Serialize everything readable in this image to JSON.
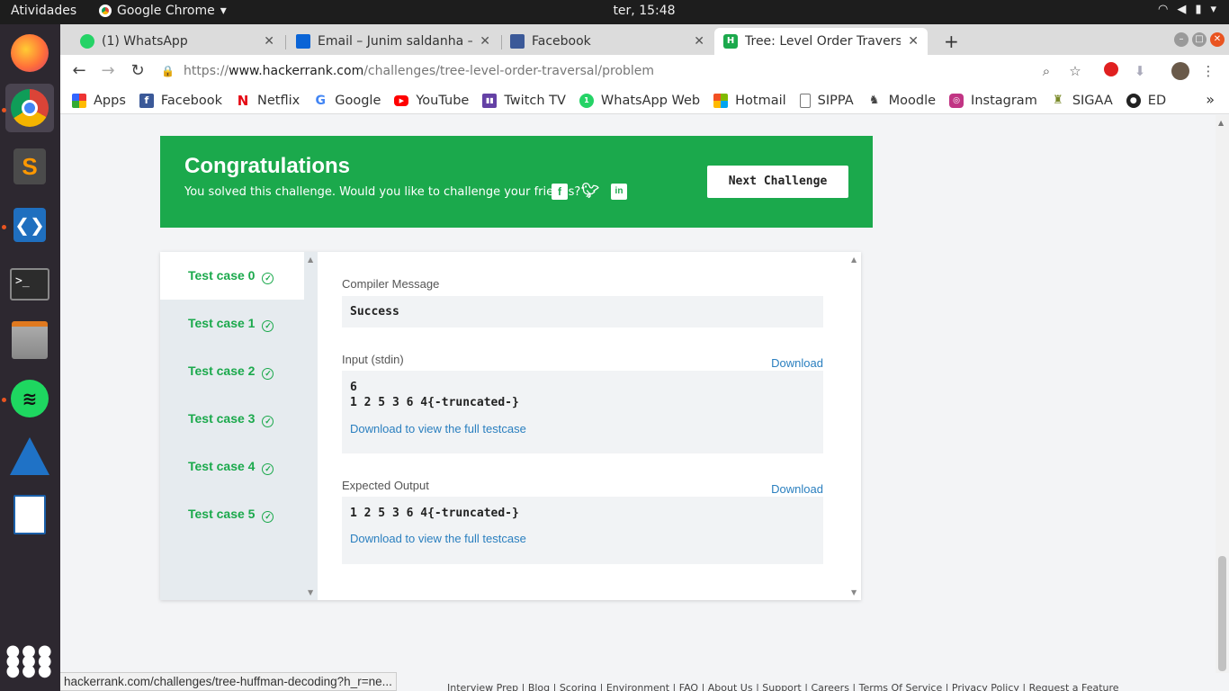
{
  "system": {
    "activities": "Atividades",
    "app_name": "Google Chrome",
    "clock": "ter, 15:48"
  },
  "tabs": [
    {
      "title": "(1) WhatsApp",
      "favicon_color": "#25d366"
    },
    {
      "title": "Email – Junim saldanha – O",
      "favicon_color": "#0a64d6"
    },
    {
      "title": "Facebook",
      "favicon_color": "#3b5998"
    },
    {
      "title": "Tree: Level Order Traversa",
      "favicon_color": "#1ba94c",
      "active": true
    }
  ],
  "address": {
    "protocol": "https://",
    "host": "www.hackerrank.com",
    "path": "/challenges/tree-level-order-traversal/problem"
  },
  "bookmarks": [
    {
      "label": "Apps",
      "icon": "apps-grid-icon",
      "color": "#e33"
    },
    {
      "label": "Facebook",
      "icon": "facebook-icon",
      "color": "#3b5998"
    },
    {
      "label": "Netflix",
      "icon": "netflix-icon",
      "color": "#e50914"
    },
    {
      "label": "Google",
      "icon": "google-icon",
      "color": "#4285f4"
    },
    {
      "label": "YouTube",
      "icon": "youtube-icon",
      "color": "#ff0000"
    },
    {
      "label": "Twitch TV",
      "icon": "twitch-icon",
      "color": "#6441a5"
    },
    {
      "label": "WhatsApp Web",
      "icon": "whatsapp-icon",
      "color": "#25d366"
    },
    {
      "label": "Hotmail",
      "icon": "microsoft-icon",
      "color": "#f25022"
    },
    {
      "label": "SIPPA",
      "icon": "page-icon",
      "color": "#999"
    },
    {
      "label": "Moodle",
      "icon": "moodle-icon",
      "color": "#444"
    },
    {
      "label": "Instagram",
      "icon": "instagram-icon",
      "color": "#c13584"
    },
    {
      "label": "SIGAA",
      "icon": "sigaa-icon",
      "color": "#7a8a2a"
    },
    {
      "label": "ED",
      "icon": "github-icon",
      "color": "#222"
    }
  ],
  "congrats": {
    "title": "Congratulations",
    "subtitle": "You solved this challenge. Would you like to challenge your friends?",
    "next_button": "Next Challenge",
    "bg_color": "#1ba94c"
  },
  "test_cases": [
    {
      "label": "Test case 0",
      "active": true
    },
    {
      "label": "Test case 1"
    },
    {
      "label": "Test case 2"
    },
    {
      "label": "Test case 3"
    },
    {
      "label": "Test case 4"
    },
    {
      "label": "Test case 5"
    }
  ],
  "result": {
    "compiler_label": "Compiler Message",
    "compiler_message": "Success",
    "input_label": "Input (stdin)",
    "input_download": "Download",
    "input_lines": [
      "6",
      "1 2 5 3 6 4{-truncated-}"
    ],
    "input_full_link": "Download to view the full testcase",
    "expected_label": "Expected Output",
    "expected_download": "Download",
    "expected_lines": [
      "1 2 5 3 6 4{-truncated-}"
    ],
    "expected_full_link": "Download to view the full testcase"
  },
  "status_link": "hackerrank.com/challenges/tree-huffman-decoding?h_r=ne...",
  "footer_text": "Interview Prep | Blog | Scoring | Environment | FAQ | About Us | Support | Careers | Terms Of Service | Privacy Policy | Request a Feature"
}
